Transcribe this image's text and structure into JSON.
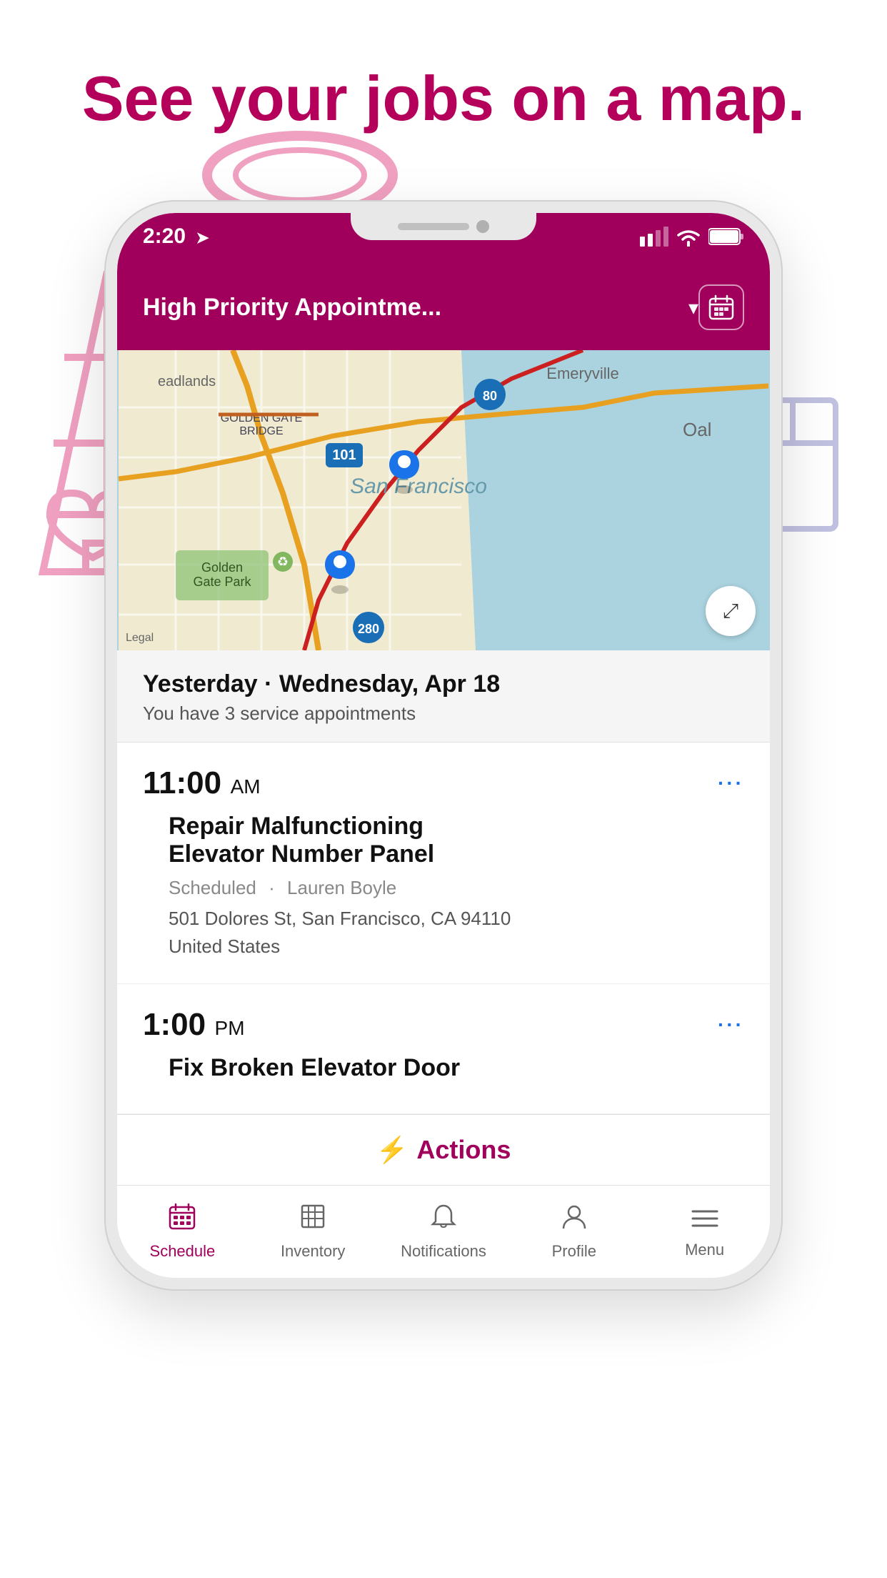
{
  "page": {
    "bg_title": "See your jobs on a map.",
    "status": {
      "time": "2:20",
      "time_arrow": "➤"
    },
    "header": {
      "title": "High Priority Appointme...",
      "dropdown_label": "▾",
      "calendar_icon": "calendar"
    },
    "map": {
      "legal_text": "Legal",
      "expand_icon": "⤢"
    },
    "date_section": {
      "date_label": "Yesterday · Wednesday, Apr 18",
      "subtitle": "You have 3 service appointments"
    },
    "appointments": [
      {
        "time": "11:00",
        "period": "AM",
        "title": "Repair Malfunctioning\nElevator Number Panel",
        "status": "Scheduled",
        "technician": "Lauren Boyle",
        "address_line1": "501 Dolores St, San Francisco, CA 94110",
        "address_line2": "United States"
      },
      {
        "time": "1:00",
        "period": "PM",
        "title": "Fix Broken Elevator Door",
        "status": "",
        "technician": "",
        "address_line1": "",
        "address_line2": ""
      }
    ],
    "actions_button": "Actions",
    "bottom_nav": [
      {
        "id": "schedule",
        "label": "Schedule",
        "icon": "schedule",
        "active": true
      },
      {
        "id": "inventory",
        "label": "Inventory",
        "icon": "inventory",
        "active": false
      },
      {
        "id": "notifications",
        "label": "Notifications",
        "icon": "notifications",
        "active": false
      },
      {
        "id": "profile",
        "label": "Profile",
        "icon": "profile",
        "active": false
      },
      {
        "id": "menu",
        "label": "Menu",
        "icon": "menu",
        "active": false
      }
    ]
  }
}
